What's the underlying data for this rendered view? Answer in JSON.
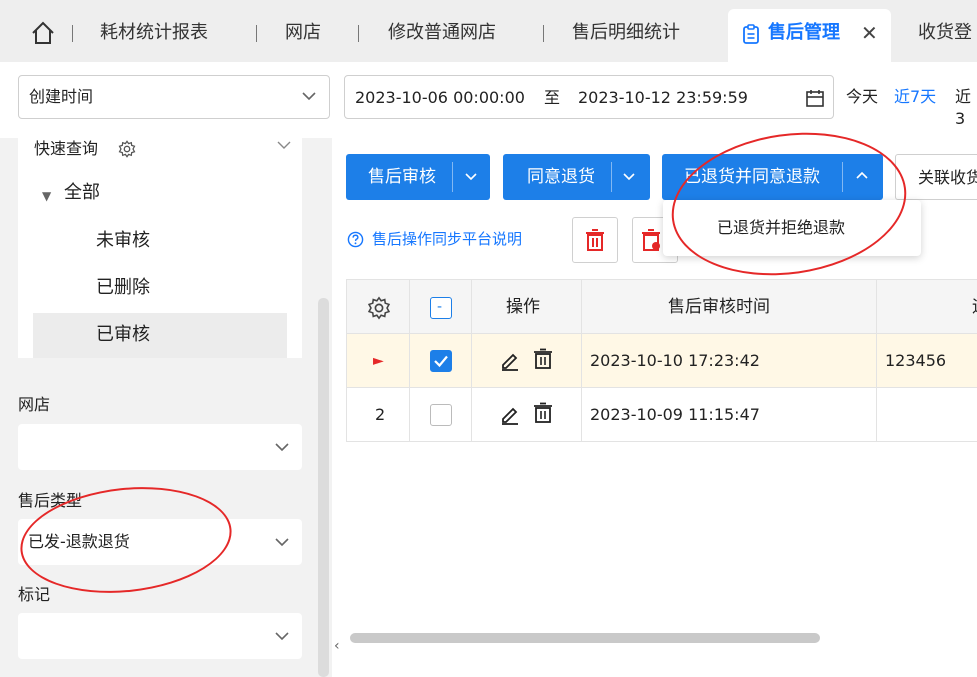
{
  "tabs": {
    "items": [
      "耗材统计报表",
      "网店",
      "修改普通网店",
      "售后明细统计"
    ],
    "active": "售后管理",
    "close": "✕",
    "next": "收货登"
  },
  "filters": {
    "time_field": "创建时间",
    "date_from": "2023-10-06 00:00:00",
    "date_to_sep": "至",
    "date_to": "2023-10-12 23:59:59",
    "quick_today": "今天",
    "quick_7days": "近7天",
    "quick_more": "近3"
  },
  "left": {
    "quick_query": "快速查询",
    "tree_root": "全部",
    "tree_items": [
      "未审核",
      "已删除",
      "已审核"
    ],
    "shop_label": "网店",
    "shop_value": "",
    "type_label": "售后类型",
    "type_value": "已发-退款退货",
    "mark_label": "标记",
    "mark_value": ""
  },
  "toolbar": {
    "audit": "售后审核",
    "agree_return": "同意退货",
    "returned_agree_refund": "已退货并同意退款",
    "link_receive": "关联收货",
    "help": "售后操作同步平台说明",
    "dropdown_item": "已退货并拒绝退款"
  },
  "table": {
    "headers": [
      "操作",
      "售后审核时间",
      "运"
    ],
    "header_check": "-",
    "rows": [
      {
        "index": "►",
        "checked": true,
        "time": "2023-10-10 17:23:42",
        "extra": "123456"
      },
      {
        "index": "2",
        "checked": false,
        "time": "2023-10-09 11:15:47",
        "extra": ""
      }
    ]
  },
  "colors": {
    "primary": "#1d7fe8",
    "link": "#1677ff",
    "annotation": "#e52828",
    "selected_row": "#fff8e6"
  },
  "misc": {
    "scroll_left": "‹"
  }
}
